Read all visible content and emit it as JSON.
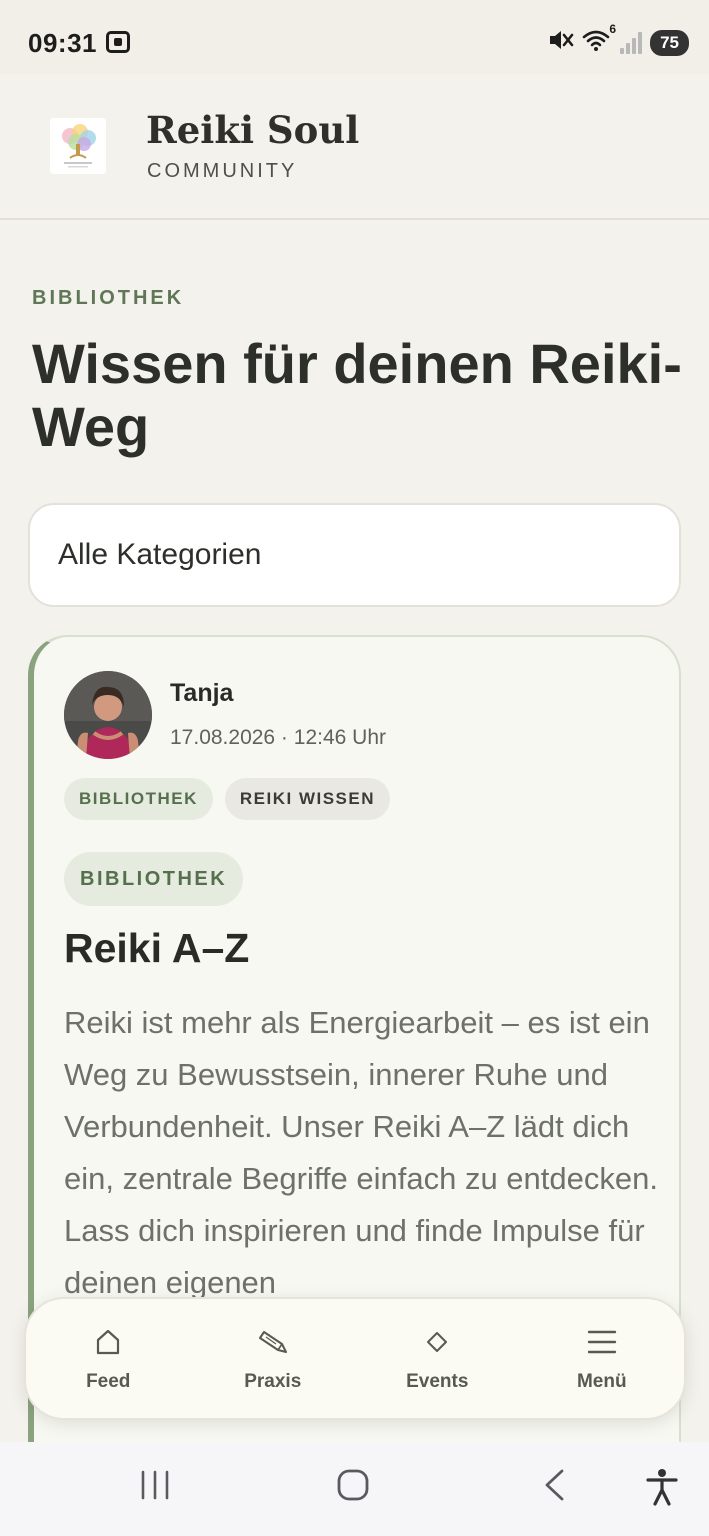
{
  "status_bar": {
    "time": "09:31",
    "battery": "75",
    "wifi_badge": "6",
    "icons": [
      "screen-record-icon",
      "mute-icon",
      "wifi-icon",
      "signal-icon",
      "battery-icon"
    ]
  },
  "header": {
    "title": "Reiki Soul",
    "subtitle": "COMMUNITY",
    "logo_icon": "tree-of-life-logo"
  },
  "page": {
    "eyebrow": "BIBLIOTHEK",
    "title": "Wissen für deinen Reiki-Weg"
  },
  "category_select": {
    "selected": "Alle Kategorien"
  },
  "post": {
    "author": "Tanja",
    "date": "17.08.2026 · 12:46 Uhr",
    "tags": [
      "BIBLIOTHEK",
      "REIKI WISSEN"
    ],
    "category": "BIBLIOTHEK",
    "title": "Reiki A–Z",
    "excerpt": "Reiki ist mehr als Energiearbeit – es ist ein Weg zu Bewusstsein, innerer Ruhe und Verbundenheit. Unser Reiki A–Z lädt dich ein, zentrale Begriffe einfach zu entdecken. Lass dich inspirieren und finde Impulse für deinen eigenen"
  },
  "bottom_nav": {
    "items": [
      {
        "label": "Feed",
        "icon": "home-icon"
      },
      {
        "label": "Praxis",
        "icon": "pencil-icon"
      },
      {
        "label": "Events",
        "icon": "diamond-icon"
      },
      {
        "label": "Menü",
        "icon": "hamburger-icon"
      }
    ]
  },
  "colors": {
    "background": "#f4f2ec",
    "accent_green": "#5f7757",
    "card_border_accent": "#8aa37f",
    "text_dark": "#2d2f2a"
  }
}
